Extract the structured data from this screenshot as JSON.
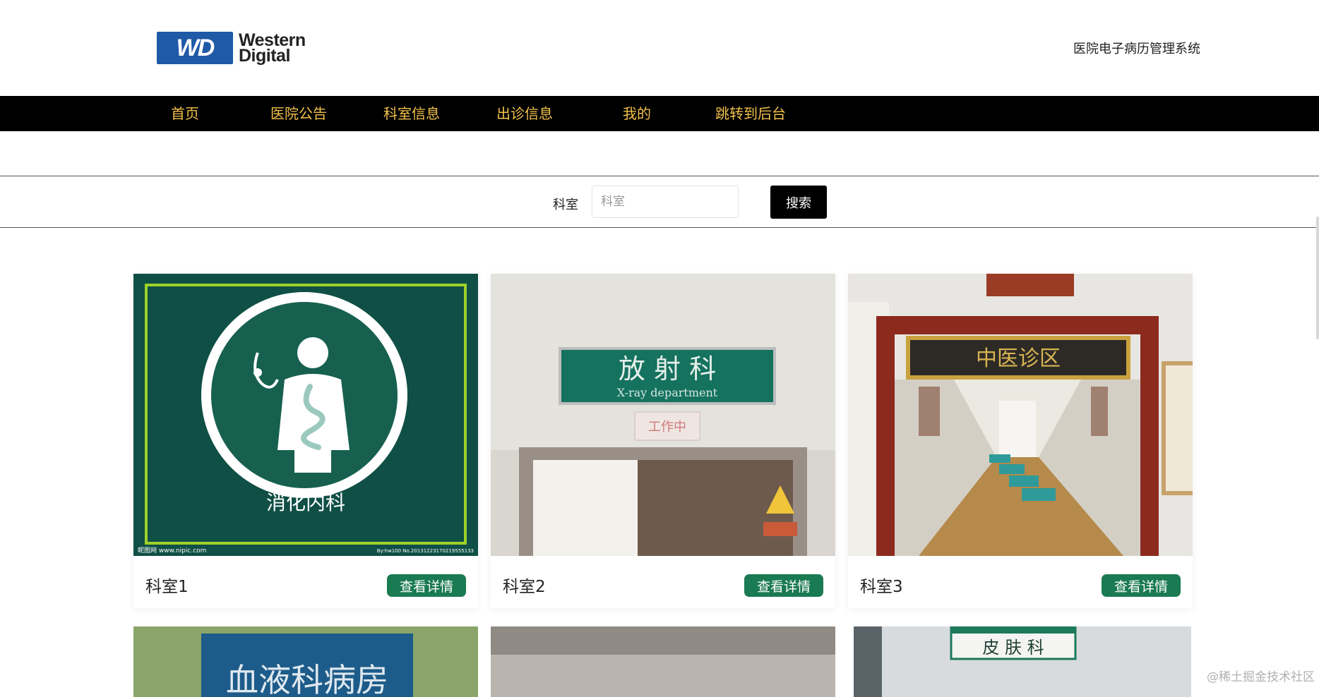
{
  "header": {
    "logo": {
      "mark_text": "WD",
      "line1": "Western",
      "line2": "Digital"
    },
    "system_title": "医院电子病历管理系统"
  },
  "nav": {
    "items": [
      {
        "label": "首页"
      },
      {
        "label": "医院公告"
      },
      {
        "label": "科室信息"
      },
      {
        "label": "出诊信息"
      },
      {
        "label": "我的"
      },
      {
        "label": "跳转到后台"
      }
    ]
  },
  "search": {
    "label": "科室",
    "placeholder": "科室",
    "button_label": "搜索"
  },
  "cards": [
    {
      "name": "科室1",
      "button_label": "查看详情",
      "image": "digestive-medicine-sign-image",
      "image_text": "消化内科",
      "image_footer_left": "昵图网 www.nipic.com",
      "image_footer_right": "By:hw100 No.20131223170219555133"
    },
    {
      "name": "科室2",
      "button_label": "查看详情",
      "image": "radiology-department-door-image",
      "image_text": "放 射 科",
      "image_subtext": "X-ray department",
      "image_badge": "工作中"
    },
    {
      "name": "科室3",
      "button_label": "查看详情",
      "image": "tcm-clinic-corridor-image",
      "image_text": "中医诊区"
    }
  ],
  "cards_row2": [
    {
      "image": "hematology-ward-sign-image",
      "image_text": "血液科病房"
    },
    {
      "image": "corridor-wall-image"
    },
    {
      "image": "dermatology-sign-image",
      "image_text": "皮 肤 科"
    }
  ],
  "watermark": "@稀土掘金技术社区",
  "colors": {
    "nav_background": "#000000",
    "nav_text": "#f3c04b",
    "button_green": "#1a7a52",
    "logo_blue": "#1f5aa6"
  }
}
